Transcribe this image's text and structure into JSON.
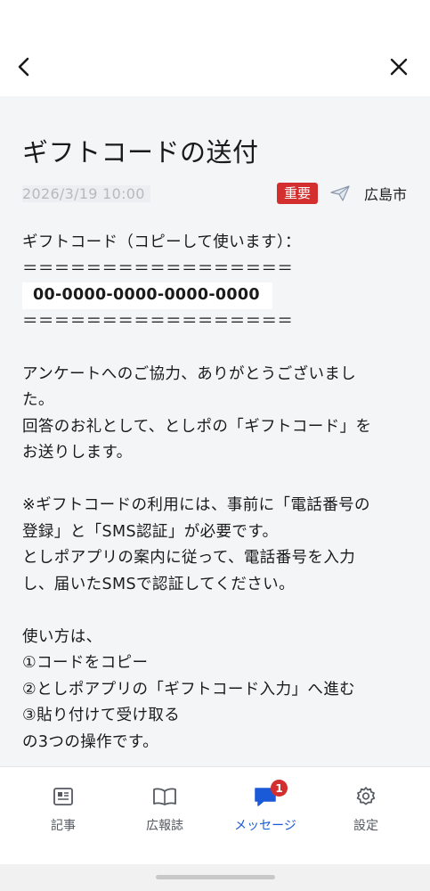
{
  "message": {
    "title": "ギフトコードの送付",
    "date": "2026/3/19 10:00",
    "badge": "重要",
    "sender": "広島市",
    "body": {
      "l1": "ギフトコード（コピーして使います）：",
      "sep1": "＝＝＝＝＝＝＝＝＝＝＝＝＝＝＝＝＝",
      "code": "00-0000-0000-0000-0000",
      "sep2": "＝＝＝＝＝＝＝＝＝＝＝＝＝＝＝＝＝",
      "l3": "アンケートへのご協力、ありがとうございまし",
      "l4": "た。",
      "l5": "回答のお礼として、としポの「ギフトコード」を",
      "l6": "お送りします。",
      "l8": "※ギフトコードの利用には、事前に「電話番号の",
      "l9": "登録」と「SMS認証」が必要です。",
      "l10": "としポアプリの案内に従って、電話番号を入力",
      "l11": "し、届いたSMSで認証してください。",
      "l13": "使い方は、",
      "l14": "①コードをコピー",
      "l15": "②としポアプリの「ギフトコード入力」へ進む",
      "l16": "③貼り付けて受け取る",
      "l17": "の3つの操作です。"
    }
  },
  "tabs": {
    "articles": "記事",
    "magazine": "広報誌",
    "messages": "メッセージ",
    "messages_badge": "1",
    "settings": "設定"
  },
  "icons": {
    "back": "chevron-left-icon",
    "close": "close-icon",
    "sender": "paper-plane-icon"
  },
  "colors": {
    "accent": "#1a5ad8",
    "badge": "#d32f2f"
  }
}
